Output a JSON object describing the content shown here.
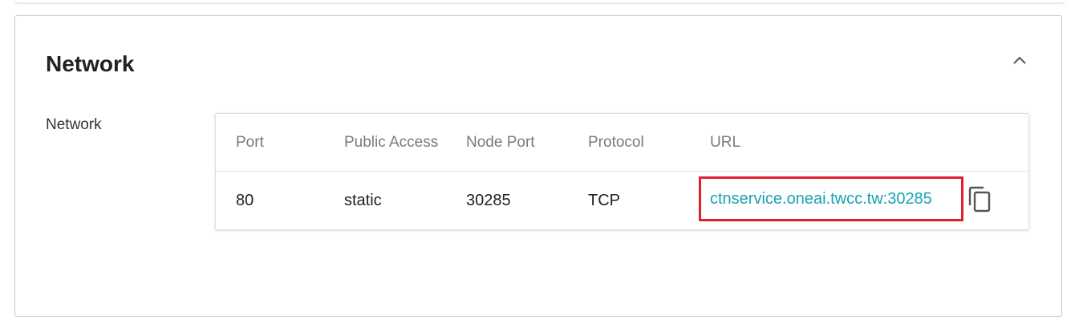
{
  "section": {
    "title": "Network",
    "collapse_icon": "chevron-up-icon"
  },
  "field": {
    "label": "Network"
  },
  "table": {
    "headers": [
      "Port",
      "Public Access",
      "Node Port",
      "Protocol",
      "URL"
    ],
    "rows": [
      {
        "port": "80",
        "public_access": "static",
        "node_port": "30285",
        "protocol": "TCP",
        "url": "ctnservice.oneai.twcc.tw:30285",
        "copy_icon": "copy-icon"
      }
    ]
  },
  "colors": {
    "link": "#1ba1b1",
    "highlight_box": "#e0202a",
    "header_text": "#7a7a7a"
  }
}
